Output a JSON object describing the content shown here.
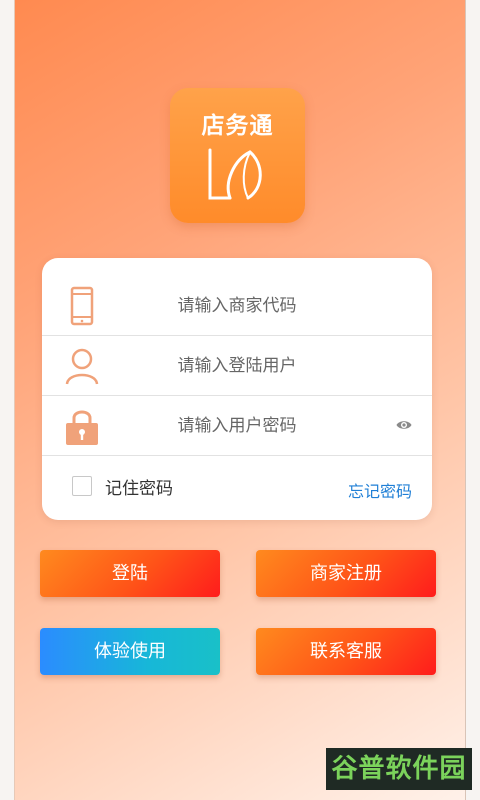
{
  "logo": {
    "title": "店务通",
    "mark_icon": "app-logo-mark-icon",
    "color_top": "#ffa24a",
    "color_bottom": "#ff8b2a"
  },
  "login_form": {
    "merchant_code": {
      "placeholder": "请输入商家代码",
      "value": "",
      "icon": "phone-icon"
    },
    "username": {
      "placeholder": "请输入登陆用户",
      "value": "",
      "icon": "user-icon"
    },
    "password": {
      "placeholder": "请输入用户密码",
      "value": "",
      "icon": "lock-icon",
      "toggle_icon": "eye-icon"
    },
    "remember": {
      "label": "记住密码",
      "checked": false
    },
    "forgot_link": "忘记密码"
  },
  "buttons": {
    "login": "登陆",
    "register": "商家注册",
    "trial": "体验使用",
    "support": "联系客服"
  },
  "watermark": {
    "text": "谷普软件园"
  },
  "colors": {
    "accent_orange": "#ff8a50",
    "icon_orange": "#f0a27a",
    "link_blue": "#1f7fd6",
    "button_red_start": "#ff8a1e",
    "button_red_end": "#ff1c1c",
    "button_blue_start": "#2b8cff",
    "button_blue_end": "#19c0c8"
  }
}
